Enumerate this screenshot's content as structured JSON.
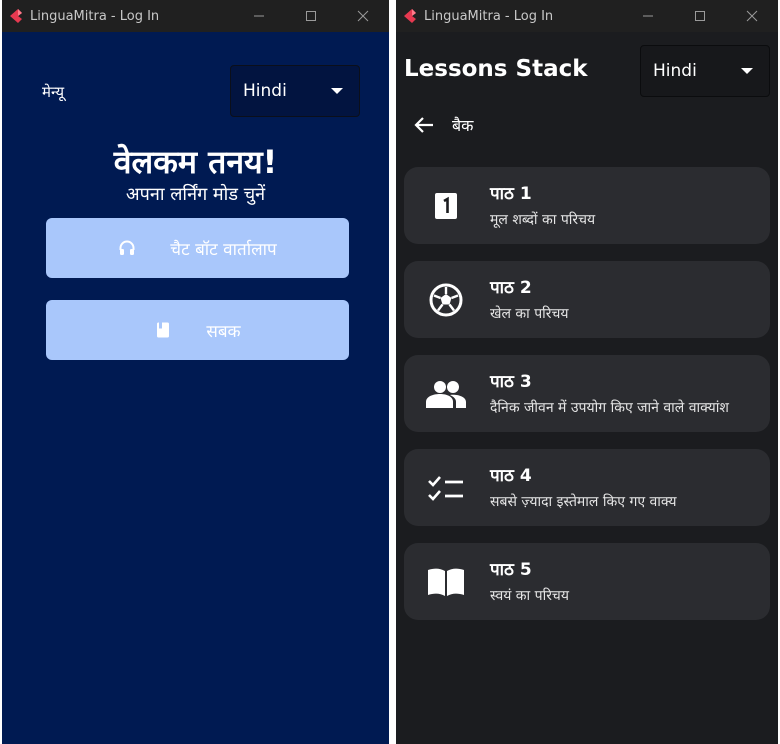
{
  "left_window": {
    "title": "LinguaMitra - Log In",
    "menu_label": "मेन्यू",
    "language": "Hindi",
    "welcome": "वेलकम तनय!",
    "subtitle": "अपना लर्निंग मोड चुनें",
    "buttons": [
      {
        "label": "चैट बॉट वार्तालाप",
        "icon": "headphones-icon"
      },
      {
        "label": "सबक",
        "icon": "book-icon"
      }
    ]
  },
  "right_window": {
    "title": "LinguaMitra - Log In",
    "header": "Lessons Stack",
    "language": "Hindi",
    "back_label": "बैक",
    "lessons": [
      {
        "title": "पाठ 1",
        "description": "मूल शब्दों का परिचय",
        "icon": "number-one-icon"
      },
      {
        "title": "पाठ 2",
        "description": "खेल का परिचय",
        "icon": "soccer-ball-icon"
      },
      {
        "title": "पाठ 3",
        "description": "दैनिक जीवन में उपयोग किए जाने वाले वाक्यांश",
        "icon": "people-icon"
      },
      {
        "title": "पाठ 4",
        "description": "सबसे ज़्यादा इस्तेमाल किए गए वाक्य",
        "icon": "checklist-icon"
      },
      {
        "title": "पाठ 5",
        "description": "स्वयं का परिचय",
        "icon": "open-book-icon"
      }
    ]
  },
  "colors": {
    "left_background": "#001a52",
    "right_background": "#1b1c1f",
    "button_fill": "#a9c7fb",
    "card_fill": "#2b2c30",
    "logo_accent": "#e63950"
  }
}
